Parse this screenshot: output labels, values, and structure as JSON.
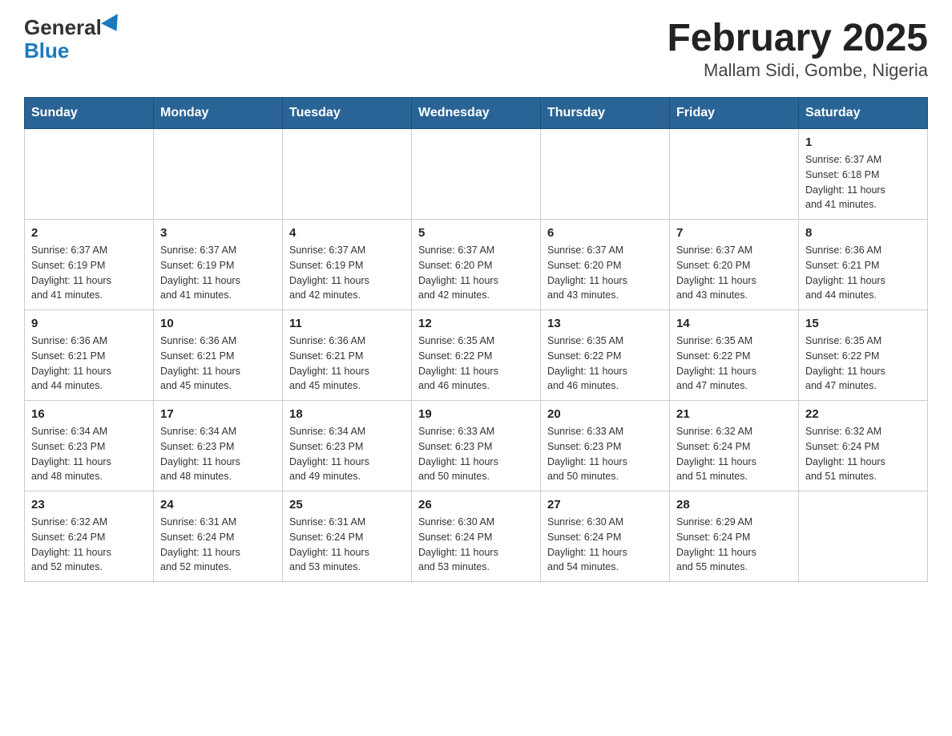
{
  "logo": {
    "general": "General",
    "blue": "Blue"
  },
  "title": "February 2025",
  "subtitle": "Mallam Sidi, Gombe, Nigeria",
  "weekdays": [
    "Sunday",
    "Monday",
    "Tuesday",
    "Wednesday",
    "Thursday",
    "Friday",
    "Saturday"
  ],
  "weeks": [
    [
      {
        "day": "",
        "info": ""
      },
      {
        "day": "",
        "info": ""
      },
      {
        "day": "",
        "info": ""
      },
      {
        "day": "",
        "info": ""
      },
      {
        "day": "",
        "info": ""
      },
      {
        "day": "",
        "info": ""
      },
      {
        "day": "1",
        "info": "Sunrise: 6:37 AM\nSunset: 6:18 PM\nDaylight: 11 hours\nand 41 minutes."
      }
    ],
    [
      {
        "day": "2",
        "info": "Sunrise: 6:37 AM\nSunset: 6:19 PM\nDaylight: 11 hours\nand 41 minutes."
      },
      {
        "day": "3",
        "info": "Sunrise: 6:37 AM\nSunset: 6:19 PM\nDaylight: 11 hours\nand 41 minutes."
      },
      {
        "day": "4",
        "info": "Sunrise: 6:37 AM\nSunset: 6:19 PM\nDaylight: 11 hours\nand 42 minutes."
      },
      {
        "day": "5",
        "info": "Sunrise: 6:37 AM\nSunset: 6:20 PM\nDaylight: 11 hours\nand 42 minutes."
      },
      {
        "day": "6",
        "info": "Sunrise: 6:37 AM\nSunset: 6:20 PM\nDaylight: 11 hours\nand 43 minutes."
      },
      {
        "day": "7",
        "info": "Sunrise: 6:37 AM\nSunset: 6:20 PM\nDaylight: 11 hours\nand 43 minutes."
      },
      {
        "day": "8",
        "info": "Sunrise: 6:36 AM\nSunset: 6:21 PM\nDaylight: 11 hours\nand 44 minutes."
      }
    ],
    [
      {
        "day": "9",
        "info": "Sunrise: 6:36 AM\nSunset: 6:21 PM\nDaylight: 11 hours\nand 44 minutes."
      },
      {
        "day": "10",
        "info": "Sunrise: 6:36 AM\nSunset: 6:21 PM\nDaylight: 11 hours\nand 45 minutes."
      },
      {
        "day": "11",
        "info": "Sunrise: 6:36 AM\nSunset: 6:21 PM\nDaylight: 11 hours\nand 45 minutes."
      },
      {
        "day": "12",
        "info": "Sunrise: 6:35 AM\nSunset: 6:22 PM\nDaylight: 11 hours\nand 46 minutes."
      },
      {
        "day": "13",
        "info": "Sunrise: 6:35 AM\nSunset: 6:22 PM\nDaylight: 11 hours\nand 46 minutes."
      },
      {
        "day": "14",
        "info": "Sunrise: 6:35 AM\nSunset: 6:22 PM\nDaylight: 11 hours\nand 47 minutes."
      },
      {
        "day": "15",
        "info": "Sunrise: 6:35 AM\nSunset: 6:22 PM\nDaylight: 11 hours\nand 47 minutes."
      }
    ],
    [
      {
        "day": "16",
        "info": "Sunrise: 6:34 AM\nSunset: 6:23 PM\nDaylight: 11 hours\nand 48 minutes."
      },
      {
        "day": "17",
        "info": "Sunrise: 6:34 AM\nSunset: 6:23 PM\nDaylight: 11 hours\nand 48 minutes."
      },
      {
        "day": "18",
        "info": "Sunrise: 6:34 AM\nSunset: 6:23 PM\nDaylight: 11 hours\nand 49 minutes."
      },
      {
        "day": "19",
        "info": "Sunrise: 6:33 AM\nSunset: 6:23 PM\nDaylight: 11 hours\nand 50 minutes."
      },
      {
        "day": "20",
        "info": "Sunrise: 6:33 AM\nSunset: 6:23 PM\nDaylight: 11 hours\nand 50 minutes."
      },
      {
        "day": "21",
        "info": "Sunrise: 6:32 AM\nSunset: 6:24 PM\nDaylight: 11 hours\nand 51 minutes."
      },
      {
        "day": "22",
        "info": "Sunrise: 6:32 AM\nSunset: 6:24 PM\nDaylight: 11 hours\nand 51 minutes."
      }
    ],
    [
      {
        "day": "23",
        "info": "Sunrise: 6:32 AM\nSunset: 6:24 PM\nDaylight: 11 hours\nand 52 minutes."
      },
      {
        "day": "24",
        "info": "Sunrise: 6:31 AM\nSunset: 6:24 PM\nDaylight: 11 hours\nand 52 minutes."
      },
      {
        "day": "25",
        "info": "Sunrise: 6:31 AM\nSunset: 6:24 PM\nDaylight: 11 hours\nand 53 minutes."
      },
      {
        "day": "26",
        "info": "Sunrise: 6:30 AM\nSunset: 6:24 PM\nDaylight: 11 hours\nand 53 minutes."
      },
      {
        "day": "27",
        "info": "Sunrise: 6:30 AM\nSunset: 6:24 PM\nDaylight: 11 hours\nand 54 minutes."
      },
      {
        "day": "28",
        "info": "Sunrise: 6:29 AM\nSunset: 6:24 PM\nDaylight: 11 hours\nand 55 minutes."
      },
      {
        "day": "",
        "info": ""
      }
    ]
  ]
}
